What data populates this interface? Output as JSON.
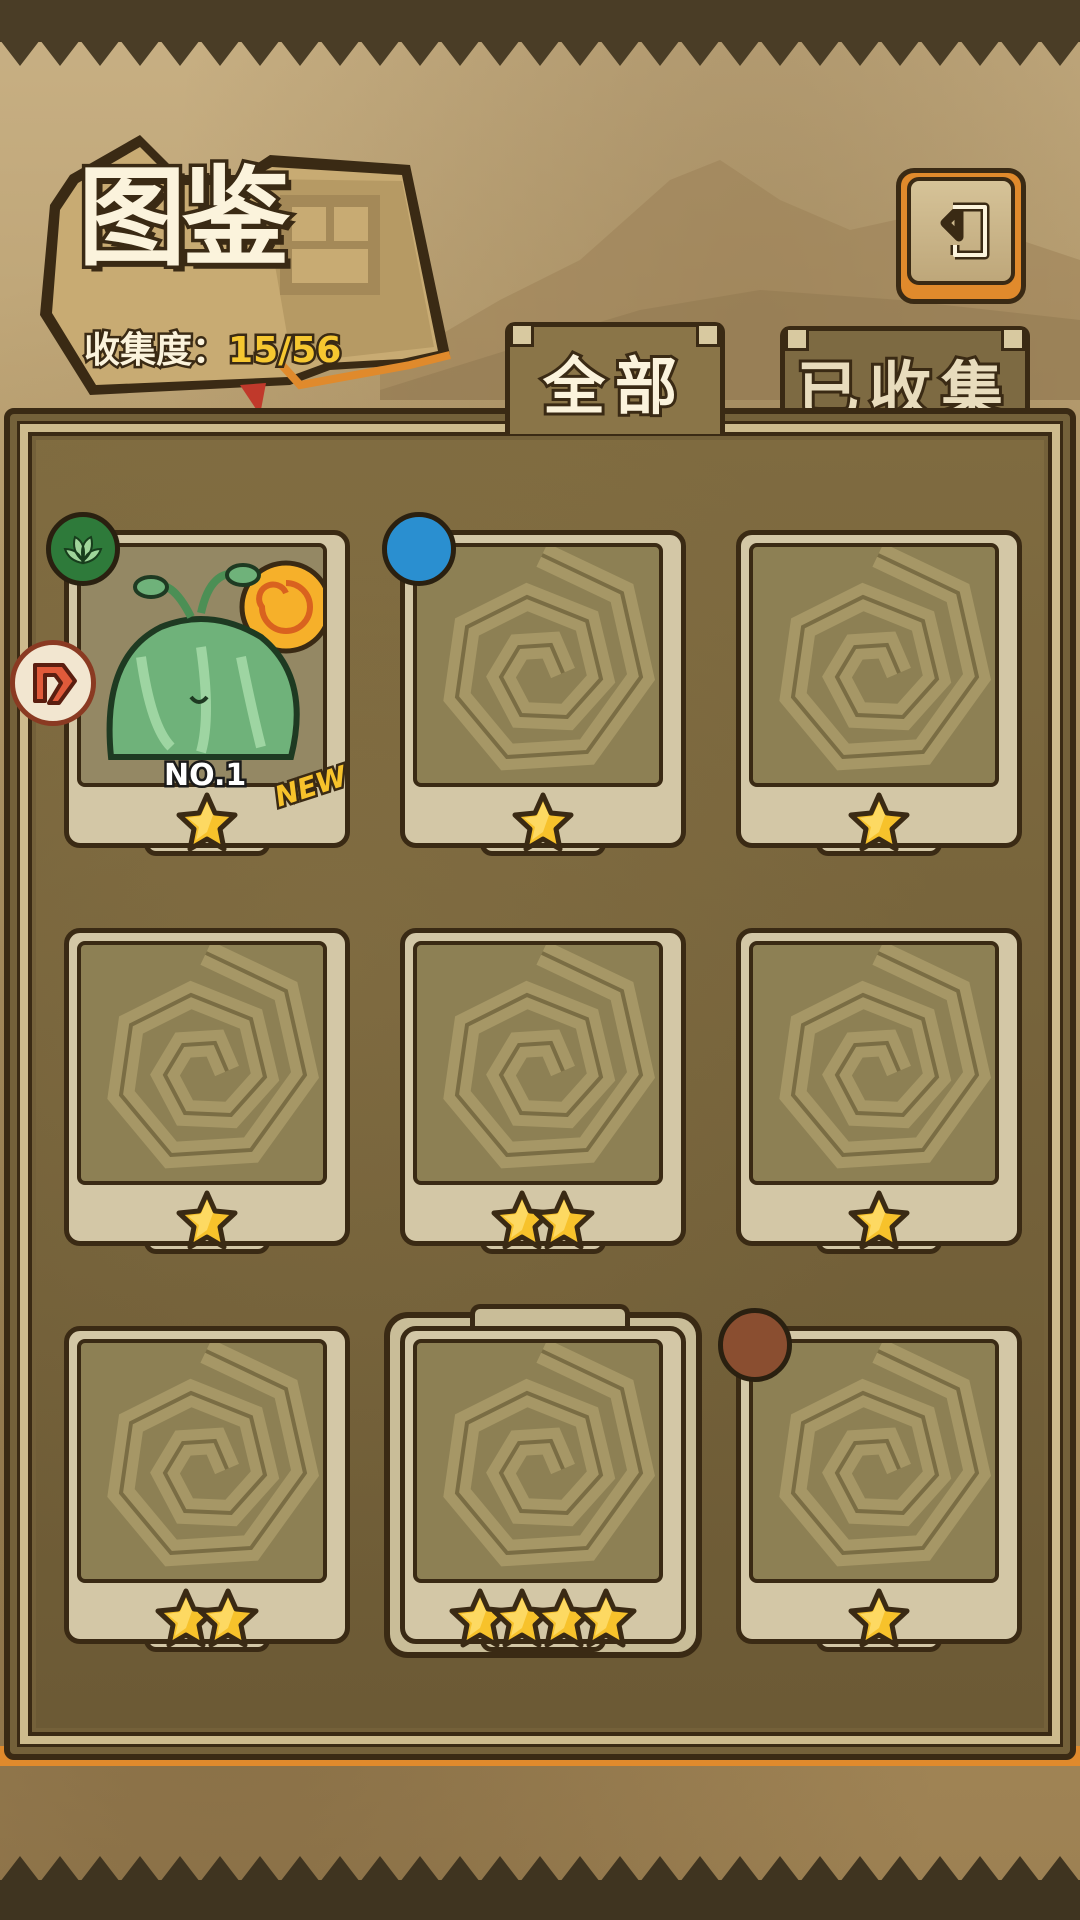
{
  "header": {
    "title": "图鉴",
    "collection_label": "收集度：",
    "collection_value": "15/56"
  },
  "tabs": [
    {
      "label": "全部",
      "active": true
    },
    {
      "label": "已收集",
      "active": false
    }
  ],
  "back_button": {
    "icon": "return-arrow-icon"
  },
  "cards": [
    {
      "number_label": "NO.1",
      "badge": "NEW",
      "stars": 1,
      "element": "leaf",
      "class": "attack",
      "revealed": true
    },
    {
      "stars": 1,
      "element": "water",
      "revealed": false
    },
    {
      "stars": 1,
      "revealed": false
    },
    {
      "stars": 1,
      "revealed": false
    },
    {
      "stars": 2,
      "revealed": false
    },
    {
      "stars": 1,
      "revealed": false
    },
    {
      "stars": 2,
      "revealed": false
    },
    {
      "stars": 4,
      "revealed": false,
      "rare_frame": true
    },
    {
      "stars": 1,
      "element": "earth",
      "revealed": false
    }
  ],
  "colors": {
    "accent_orange": "#e08a2c",
    "star_yellow": "#f7c22b",
    "outline": "#3a2a14",
    "panel": "#74613a"
  }
}
